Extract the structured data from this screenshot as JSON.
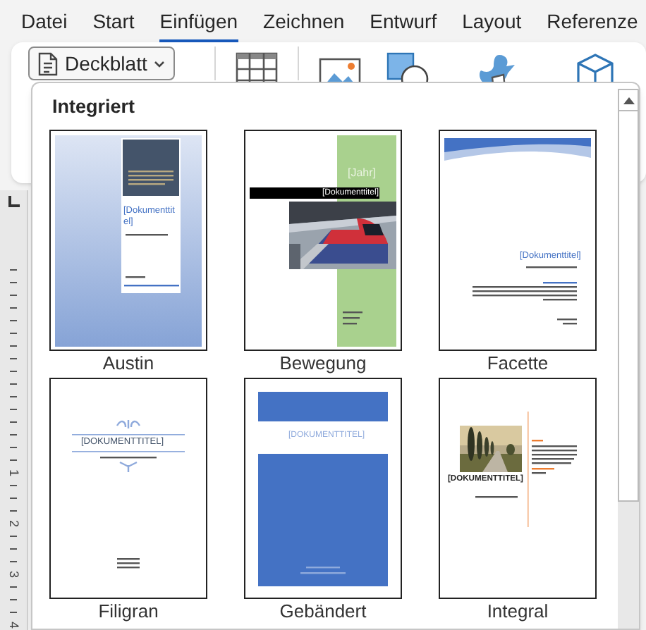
{
  "tabs": [
    {
      "label": "Datei",
      "selected": false
    },
    {
      "label": "Start",
      "selected": false
    },
    {
      "label": "Einfügen",
      "selected": true
    },
    {
      "label": "Zeichnen",
      "selected": false
    },
    {
      "label": "Entwurf",
      "selected": false
    },
    {
      "label": "Layout",
      "selected": false
    },
    {
      "label": "Referenze",
      "selected": false
    }
  ],
  "cover_page_button": {
    "label": "Deckblatt"
  },
  "ruler": {
    "numbers": [
      "1",
      "2",
      "3",
      "4"
    ]
  },
  "gallery": {
    "heading": "Integriert",
    "items": [
      {
        "name": "Austin",
        "kind": "austin",
        "preview_texts": [
          "[Dokumenttitel]"
        ]
      },
      {
        "name": "Bewegung",
        "kind": "bewegung",
        "preview_texts": [
          "[Jahr]",
          "[Dokumenttitel]"
        ]
      },
      {
        "name": "Facette",
        "kind": "facette",
        "preview_texts": [
          "[Dokumenttitel]"
        ]
      },
      {
        "name": "Filigran",
        "kind": "filigran",
        "preview_texts": [
          "[DOKUMENTTITEL]"
        ]
      },
      {
        "name": "Gebändert",
        "kind": "gebaendert",
        "preview_texts": [
          "[DOKUMENTTITEL]"
        ]
      },
      {
        "name": "Integral",
        "kind": "integral",
        "preview_texts": [
          "[DOKUMENTTITEL]"
        ]
      }
    ]
  }
}
